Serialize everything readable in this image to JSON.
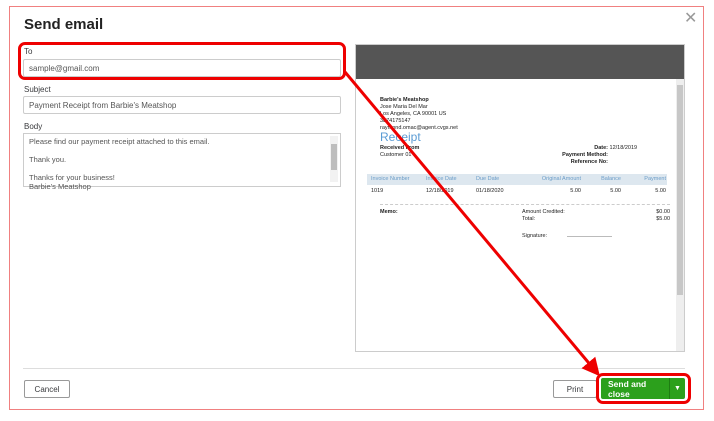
{
  "dialog": {
    "title": "Send email",
    "close_icon": "close-icon"
  },
  "form": {
    "to_label": "To",
    "to_value": "sample@gmail.com",
    "subject_label": "Subject",
    "subject_value": "Payment Receipt from Barbie's Meatshop",
    "body_label": "Body",
    "body_lines": [
      "Please find our payment receipt attached to this email.",
      "",
      "Thank you.",
      "",
      "Thanks for your business!",
      "Barbie's Meatshop"
    ]
  },
  "preview": {
    "company": "Barbie's Meatshop",
    "address1": "Jose Maria Del Mar",
    "address2": "Los Angeles, CA  90001 US",
    "phone": "3874175147",
    "email": "raymond.omac@agent.cvgs.net",
    "doc_title": "Receipt",
    "received_from_label": "Received From",
    "customer": "Customer 01",
    "date_label": "Date:",
    "date": "12/18/2019",
    "payment_method_label": "Payment Method:",
    "reference_label": "Reference No:",
    "columns": [
      "Invoice Number",
      "Invoice Date",
      "Due Date",
      "Original Amount",
      "Balance",
      "Payment"
    ],
    "rows": [
      [
        "1019",
        "12/18/2019",
        "01/18/2020",
        "5.00",
        "5.00",
        "5.00"
      ]
    ],
    "memo_label": "Memo:",
    "amount_credited_label": "Amount Credited:",
    "amount_credited": "$0.00",
    "total_label": "Total:",
    "total": "$5.00",
    "signature_label": "Signature:"
  },
  "footer": {
    "cancel": "Cancel",
    "print": "Print",
    "send": "Send and close",
    "send_caret": "▼"
  },
  "colors": {
    "primary": "#2ca01c",
    "annotation": "#ee0000"
  }
}
